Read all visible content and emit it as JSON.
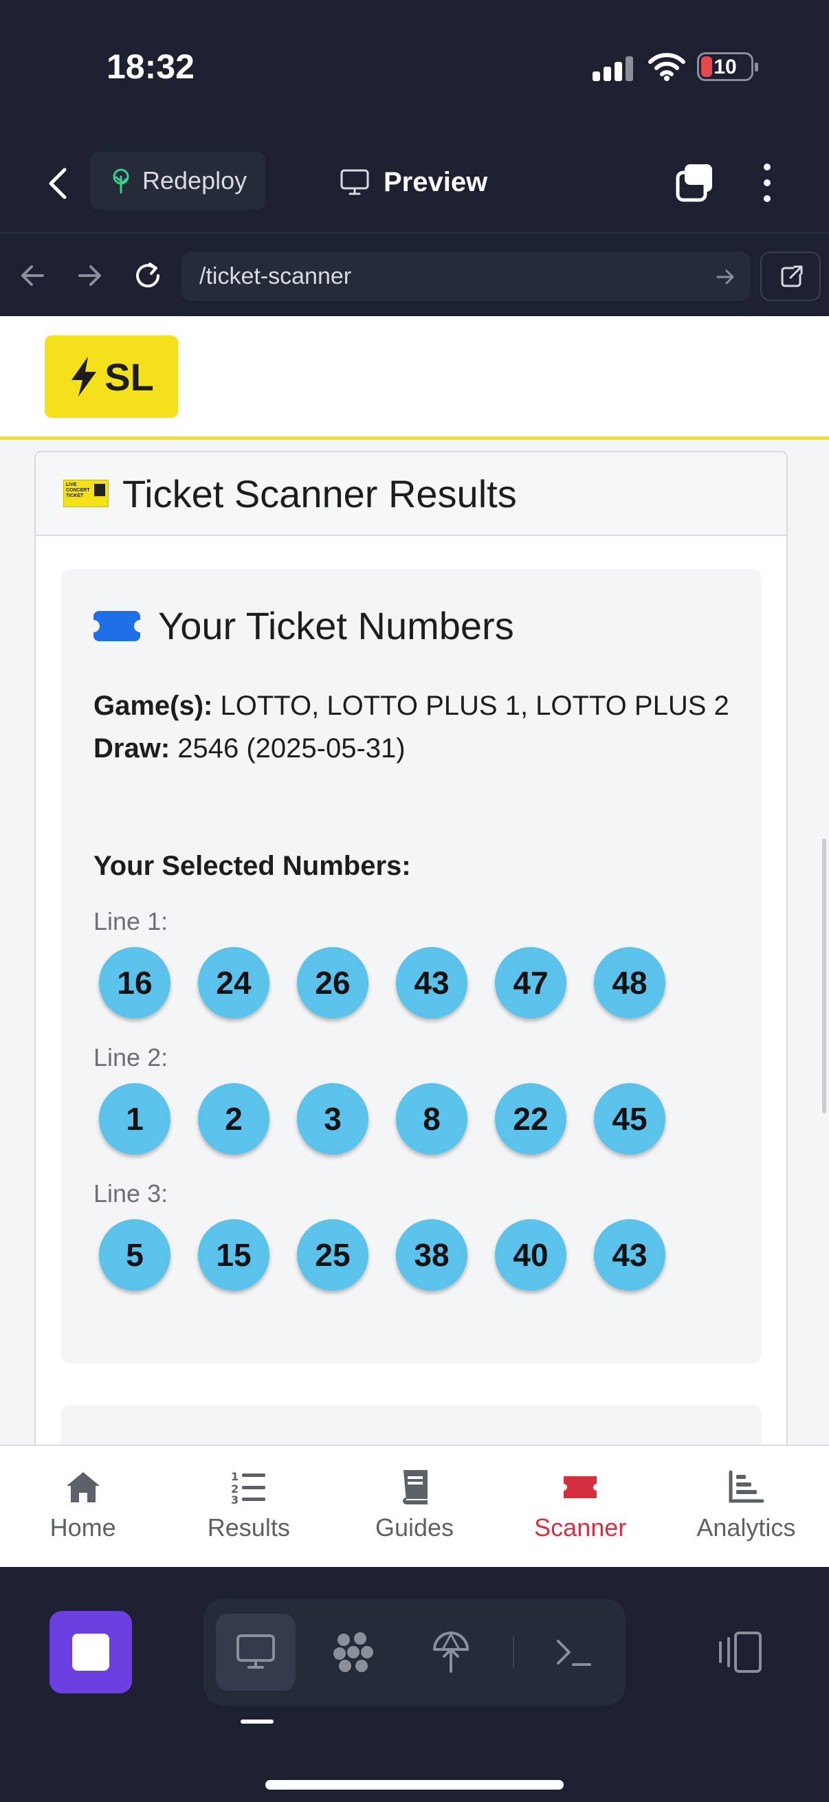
{
  "status_bar": {
    "time": "18:32",
    "battery": "10",
    "battery_color": "#e5484d"
  },
  "app_header": {
    "redeploy_label": "Redeploy",
    "preview_label": "Preview"
  },
  "url_bar": {
    "url": "/ticket-scanner"
  },
  "site": {
    "logo_text": "SL",
    "brand_color": "#f5e11a"
  },
  "card": {
    "title": "Ticket Scanner Results"
  },
  "ticket": {
    "panel_title": "Your Ticket Numbers",
    "game_label": "Game(s):",
    "game_value": "LOTTO, LOTTO PLUS 1, LOTTO PLUS 2",
    "draw_label": "Draw:",
    "draw_value": "2546 (2025-05-31)",
    "selected_heading": "Your Selected Numbers:",
    "lines": [
      {
        "label": "Line 1:",
        "numbers": [
          "16",
          "24",
          "26",
          "43",
          "47",
          "48"
        ]
      },
      {
        "label": "Line 2:",
        "numbers": [
          "1",
          "2",
          "3",
          "8",
          "22",
          "45"
        ]
      },
      {
        "label": "Line 3:",
        "numbers": [
          "5",
          "15",
          "25",
          "38",
          "40",
          "43"
        ]
      }
    ],
    "ball_color": "#5bc2ec"
  },
  "bottom_nav": {
    "items": [
      {
        "label": "Home",
        "icon": "home-icon"
      },
      {
        "label": "Results",
        "icon": "ordered-list-icon"
      },
      {
        "label": "Guides",
        "icon": "book-icon"
      },
      {
        "label": "Scanner",
        "icon": "ticket-icon",
        "active": true
      },
      {
        "label": "Analytics",
        "icon": "bar-chart-icon"
      }
    ],
    "active_color": "#d32f3f"
  }
}
